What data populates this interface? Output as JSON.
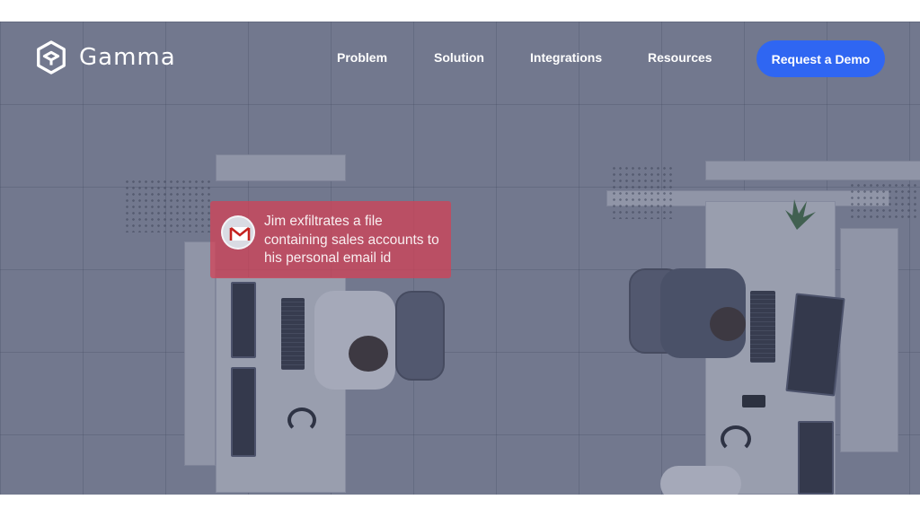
{
  "brand": {
    "name": "Gamma",
    "logo_icon": "gamma-hexagon-icon"
  },
  "nav": {
    "items": [
      {
        "label": "Problem"
      },
      {
        "label": "Solution"
      },
      {
        "label": "Integrations"
      },
      {
        "label": "Resources"
      }
    ],
    "cta_label": "Request a Demo"
  },
  "hero": {
    "alert": {
      "icon": "gmail-icon",
      "text": "Jim exfiltrates a file containing sales accounts to his personal email id"
    }
  },
  "colors": {
    "cta": "#2f66f2",
    "alert": "#d64054",
    "overlay": "#464e6e"
  }
}
